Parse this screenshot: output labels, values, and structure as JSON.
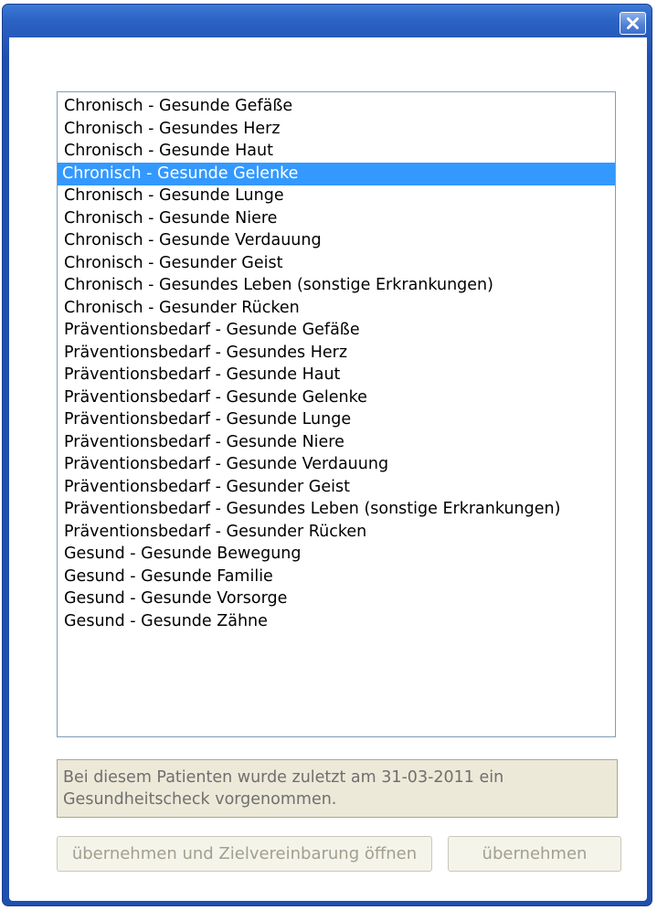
{
  "window": {
    "close_icon": "close-icon"
  },
  "list": {
    "selected_index": 3,
    "items": [
      "Chronisch - Gesunde Gefäße",
      "Chronisch - Gesundes Herz",
      "Chronisch - Gesunde Haut",
      "Chronisch - Gesunde Gelenke",
      "Chronisch - Gesunde Lunge",
      "Chronisch - Gesunde Niere",
      "Chronisch - Gesunde Verdauung",
      "Chronisch - Gesunder Geist",
      "Chronisch - Gesundes Leben (sonstige Erkrankungen)",
      "Chronisch - Gesunder Rücken",
      "Präventionsbedarf - Gesunde Gefäße",
      "Präventionsbedarf - Gesundes Herz",
      "Präventionsbedarf - Gesunde Haut",
      "Präventionsbedarf - Gesunde Gelenke",
      "Präventionsbedarf - Gesunde Lunge",
      "Präventionsbedarf - Gesunde Niere",
      "Präventionsbedarf - Gesunde Verdauung",
      "Präventionsbedarf - Gesunder Geist",
      "Präventionsbedarf - Gesundes Leben (sonstige Erkrankungen)",
      "Präventionsbedarf - Gesunder Rücken",
      "Gesund - Gesunde Bewegung",
      "Gesund - Gesunde Familie",
      "Gesund - Gesunde Vorsorge",
      "Gesund - Gesunde Zähne"
    ]
  },
  "info": {
    "text": "Bei diesem Patienten wurde zuletzt am 31-03-2011 ein Gesundheitscheck vorgenommen."
  },
  "buttons": {
    "accept_and_open": "übernehmen und Zielvereinbarung öffnen",
    "accept": "übernehmen"
  },
  "colors": {
    "titlebar": "#2b62c4",
    "selection": "#3399ff",
    "info_background": "#ece9d8"
  }
}
